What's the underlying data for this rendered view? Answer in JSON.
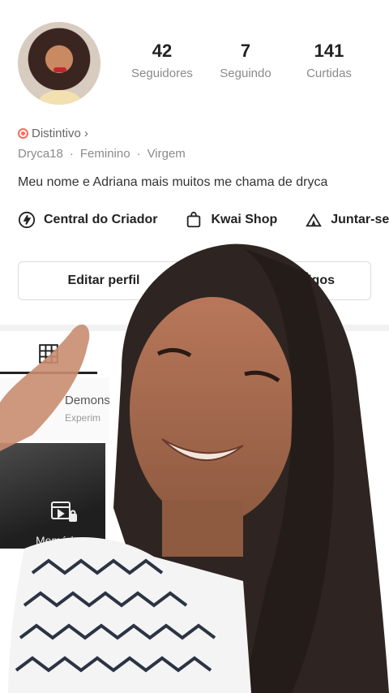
{
  "profile": {
    "stats": [
      {
        "value": "42",
        "label": "Seguidores"
      },
      {
        "value": "7",
        "label": "Seguindo"
      },
      {
        "value": "141",
        "label": "Curtidas"
      }
    ],
    "badge": "Distintivo",
    "badge_chevron": "›",
    "username": "Dryca18",
    "gender": "Feminino",
    "sign": "Virgem",
    "separator": "·",
    "bio": "Meu nome e Adriana mais muitos me chama de dryca"
  },
  "actions": [
    {
      "label": "Central do Criador",
      "icon": "lightning-icon"
    },
    {
      "label": "Kwai Shop",
      "icon": "shopping-bag-icon"
    },
    {
      "label": "Juntar-se à",
      "icon": "tent-icon"
    }
  ],
  "buttons": {
    "edit_profile": "Editar perfil",
    "friends_partial": "igos"
  },
  "posts": {
    "card_title": "Demons",
    "card_subtitle": "Experim",
    "memories_label": "Memórias"
  },
  "colors": {
    "accent": "#ff6a5a",
    "text": "#222222",
    "muted": "#8a8a8a"
  }
}
